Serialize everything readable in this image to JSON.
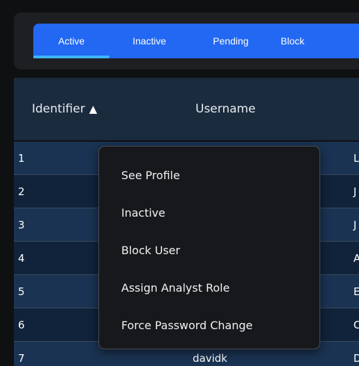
{
  "tabs": {
    "items": [
      {
        "label": "Active"
      },
      {
        "label": "Inactive"
      },
      {
        "label": "Pending"
      },
      {
        "label": "Block"
      }
    ]
  },
  "table": {
    "columns": {
      "identifier": "Identifier",
      "identifier_sort_icon": "▲",
      "username": "Username"
    },
    "rows": [
      {
        "id": "1",
        "username": "",
        "name": "L"
      },
      {
        "id": "2",
        "username": "",
        "name": "J"
      },
      {
        "id": "3",
        "username": "",
        "name": "J"
      },
      {
        "id": "4",
        "username": "",
        "name": "A"
      },
      {
        "id": "5",
        "username": "",
        "name": "E"
      },
      {
        "id": "6",
        "username": "",
        "name": "C"
      },
      {
        "id": "7",
        "username": "davidk",
        "name": "D"
      }
    ]
  },
  "context_menu": {
    "items": [
      {
        "label": "See Profile"
      },
      {
        "label": "Inactive"
      },
      {
        "label": "Block User"
      },
      {
        "label": "Assign Analyst Role"
      },
      {
        "label": "Force Password Change"
      }
    ]
  },
  "colors": {
    "tab_bar": "#2268f2",
    "tab_underline": "#3fb6ff",
    "header_bg": "#1b2b3e",
    "row_alt": "#1a3352",
    "row_base": "#10233a",
    "menu_bg": "#16181b"
  }
}
